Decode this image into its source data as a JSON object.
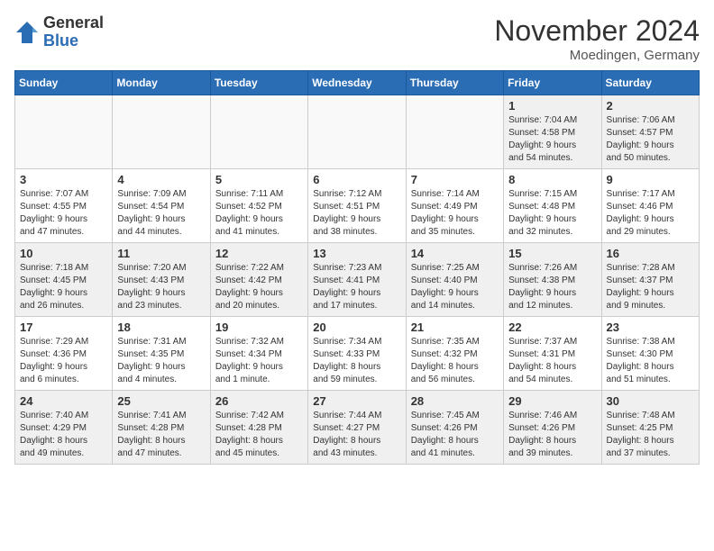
{
  "header": {
    "logo_general": "General",
    "logo_blue": "Blue",
    "title": "November 2024",
    "location": "Moedingen, Germany"
  },
  "days_of_week": [
    "Sunday",
    "Monday",
    "Tuesday",
    "Wednesday",
    "Thursday",
    "Friday",
    "Saturday"
  ],
  "weeks": [
    [
      {
        "day": "",
        "info": "",
        "empty": true
      },
      {
        "day": "",
        "info": "",
        "empty": true
      },
      {
        "day": "",
        "info": "",
        "empty": true
      },
      {
        "day": "",
        "info": "",
        "empty": true
      },
      {
        "day": "",
        "info": "",
        "empty": true
      },
      {
        "day": "1",
        "info": "Sunrise: 7:04 AM\nSunset: 4:58 PM\nDaylight: 9 hours\nand 54 minutes."
      },
      {
        "day": "2",
        "info": "Sunrise: 7:06 AM\nSunset: 4:57 PM\nDaylight: 9 hours\nand 50 minutes."
      }
    ],
    [
      {
        "day": "3",
        "info": "Sunrise: 7:07 AM\nSunset: 4:55 PM\nDaylight: 9 hours\nand 47 minutes."
      },
      {
        "day": "4",
        "info": "Sunrise: 7:09 AM\nSunset: 4:54 PM\nDaylight: 9 hours\nand 44 minutes."
      },
      {
        "day": "5",
        "info": "Sunrise: 7:11 AM\nSunset: 4:52 PM\nDaylight: 9 hours\nand 41 minutes."
      },
      {
        "day": "6",
        "info": "Sunrise: 7:12 AM\nSunset: 4:51 PM\nDaylight: 9 hours\nand 38 minutes."
      },
      {
        "day": "7",
        "info": "Sunrise: 7:14 AM\nSunset: 4:49 PM\nDaylight: 9 hours\nand 35 minutes."
      },
      {
        "day": "8",
        "info": "Sunrise: 7:15 AM\nSunset: 4:48 PM\nDaylight: 9 hours\nand 32 minutes."
      },
      {
        "day": "9",
        "info": "Sunrise: 7:17 AM\nSunset: 4:46 PM\nDaylight: 9 hours\nand 29 minutes."
      }
    ],
    [
      {
        "day": "10",
        "info": "Sunrise: 7:18 AM\nSunset: 4:45 PM\nDaylight: 9 hours\nand 26 minutes."
      },
      {
        "day": "11",
        "info": "Sunrise: 7:20 AM\nSunset: 4:43 PM\nDaylight: 9 hours\nand 23 minutes."
      },
      {
        "day": "12",
        "info": "Sunrise: 7:22 AM\nSunset: 4:42 PM\nDaylight: 9 hours\nand 20 minutes."
      },
      {
        "day": "13",
        "info": "Sunrise: 7:23 AM\nSunset: 4:41 PM\nDaylight: 9 hours\nand 17 minutes."
      },
      {
        "day": "14",
        "info": "Sunrise: 7:25 AM\nSunset: 4:40 PM\nDaylight: 9 hours\nand 14 minutes."
      },
      {
        "day": "15",
        "info": "Sunrise: 7:26 AM\nSunset: 4:38 PM\nDaylight: 9 hours\nand 12 minutes."
      },
      {
        "day": "16",
        "info": "Sunrise: 7:28 AM\nSunset: 4:37 PM\nDaylight: 9 hours\nand 9 minutes."
      }
    ],
    [
      {
        "day": "17",
        "info": "Sunrise: 7:29 AM\nSunset: 4:36 PM\nDaylight: 9 hours\nand 6 minutes."
      },
      {
        "day": "18",
        "info": "Sunrise: 7:31 AM\nSunset: 4:35 PM\nDaylight: 9 hours\nand 4 minutes."
      },
      {
        "day": "19",
        "info": "Sunrise: 7:32 AM\nSunset: 4:34 PM\nDaylight: 9 hours\nand 1 minute."
      },
      {
        "day": "20",
        "info": "Sunrise: 7:34 AM\nSunset: 4:33 PM\nDaylight: 8 hours\nand 59 minutes."
      },
      {
        "day": "21",
        "info": "Sunrise: 7:35 AM\nSunset: 4:32 PM\nDaylight: 8 hours\nand 56 minutes."
      },
      {
        "day": "22",
        "info": "Sunrise: 7:37 AM\nSunset: 4:31 PM\nDaylight: 8 hours\nand 54 minutes."
      },
      {
        "day": "23",
        "info": "Sunrise: 7:38 AM\nSunset: 4:30 PM\nDaylight: 8 hours\nand 51 minutes."
      }
    ],
    [
      {
        "day": "24",
        "info": "Sunrise: 7:40 AM\nSunset: 4:29 PM\nDaylight: 8 hours\nand 49 minutes."
      },
      {
        "day": "25",
        "info": "Sunrise: 7:41 AM\nSunset: 4:28 PM\nDaylight: 8 hours\nand 47 minutes."
      },
      {
        "day": "26",
        "info": "Sunrise: 7:42 AM\nSunset: 4:28 PM\nDaylight: 8 hours\nand 45 minutes."
      },
      {
        "day": "27",
        "info": "Sunrise: 7:44 AM\nSunset: 4:27 PM\nDaylight: 8 hours\nand 43 minutes."
      },
      {
        "day": "28",
        "info": "Sunrise: 7:45 AM\nSunset: 4:26 PM\nDaylight: 8 hours\nand 41 minutes."
      },
      {
        "day": "29",
        "info": "Sunrise: 7:46 AM\nSunset: 4:26 PM\nDaylight: 8 hours\nand 39 minutes."
      },
      {
        "day": "30",
        "info": "Sunrise: 7:48 AM\nSunset: 4:25 PM\nDaylight: 8 hours\nand 37 minutes."
      }
    ]
  ]
}
